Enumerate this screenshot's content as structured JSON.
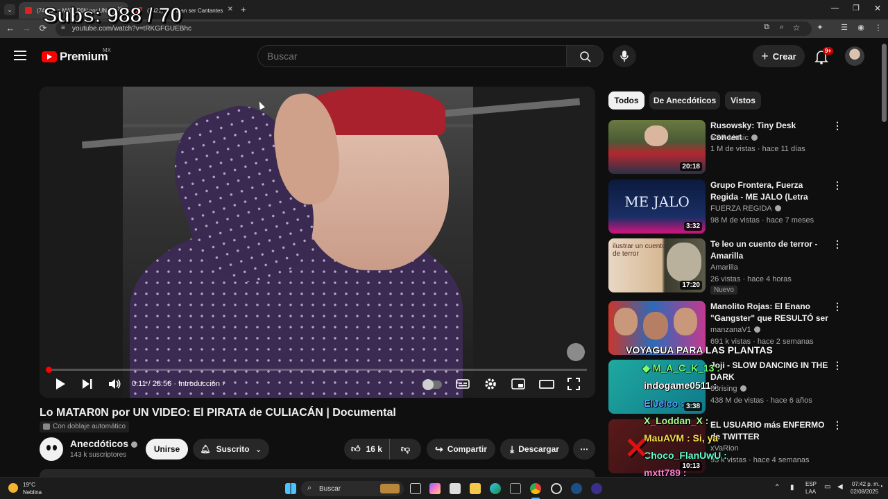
{
  "browser": {
    "tabs": [
      {
        "label": "(7421) Lo MATAR0N por UN V"
      },
      {
        "label": "(7421) Soñaban ser Cantantes"
      }
    ],
    "url": "youtube.com/watch?v=tRKGFGUEBhc",
    "overlay_counter": "Subs: 988 / 70"
  },
  "header": {
    "logo_text": "Premium",
    "region": "MX",
    "search_placeholder": "Buscar",
    "create_label": "Crear",
    "notifications_badge": "9+"
  },
  "player": {
    "current_time": "0:11 / 28:56",
    "chapter": "Introducción",
    "progress": 0.0063
  },
  "video": {
    "title": "Lo MATAR0N por UN VIDEO: El PIRATA de CULIACÁN | Documental",
    "dub_badge": "Con doblaje automático",
    "channel_name": "Anecdóticos",
    "channel_subs": "143 k suscriptores",
    "join_label": "Unirse",
    "subscribed_label": "Suscrito",
    "likes": "16 k",
    "share_label": "Compartir",
    "download_label": "Descargar"
  },
  "chips": [
    "Todos",
    "De Anecdóticos",
    "Vistos"
  ],
  "recommendations": [
    {
      "title": "Rusowsky: Tiny Desk Concert",
      "channel": "NPR Music",
      "meta": "1 M de vistas · hace 11 días",
      "duration": "20:18"
    },
    {
      "title": "Grupo Frontera, Fuerza Regida - ME JALO (Letra Oficial)",
      "channel": "FUERZA REGIDA",
      "meta": "98 M de vistas · hace 7 meses",
      "duration": "3:32",
      "thumb_text": "ME JALO"
    },
    {
      "title": "Te leo un cuento de terror - Amarilla",
      "channel": "Amarilla",
      "meta": "26 vistas · hace 4 horas",
      "duration": "17:20",
      "badge": "Nuevo",
      "thumb_text": "ilustrar un cuento de terror"
    },
    {
      "title": "Manolito Rojas: El Enano \"Gangster\" que RESULTÓ ser u...",
      "channel": "manzanaV1",
      "meta": "691 k vistas · hace 2 semanas"
    },
    {
      "title": "Joji - SLOW DANCING IN THE DARK",
      "channel": "88rising",
      "meta": "438 M de vistas · hace 6 años",
      "duration": "3:38"
    },
    {
      "title": "EL USUARIO más ENFERMO de TWITTER",
      "channel": "xVaRion",
      "meta": "93 k vistas · hace 4 semanas",
      "duration": "10:13"
    }
  ],
  "chat_overlay": [
    {
      "text": "VOYAGUA PARA LAS PLANTAS",
      "color": "#ffffff"
    },
    {
      "text": "M_A_C_K_13 :",
      "color": "#7dff6a"
    },
    {
      "text": "indogame0511 :",
      "color": "#ffffff"
    },
    {
      "text": "ElJelco :",
      "color": "#4fa3ff"
    },
    {
      "text": "X_Loddan_X :",
      "color": "#a6ff8a"
    },
    {
      "text": "MauAVM : Si, ya",
      "color": "#ffe14a"
    },
    {
      "text": "Choco_FlanUwU :",
      "color": "#63ffcf"
    },
    {
      "text": "mxtt789 :",
      "color": "#ff7fd1"
    }
  ],
  "taskbar": {
    "weather_temp": "19°C",
    "weather_desc": "Neblina",
    "search_label": "Buscar",
    "lang_top": "ESP",
    "lang_bottom": "LAA",
    "time": "07:42 p. m.",
    "date": "02/08/2025"
  },
  "colors": {
    "accent_red": "#ff0000",
    "bg": "#0f0f0f",
    "chip_bg": "#272727"
  }
}
